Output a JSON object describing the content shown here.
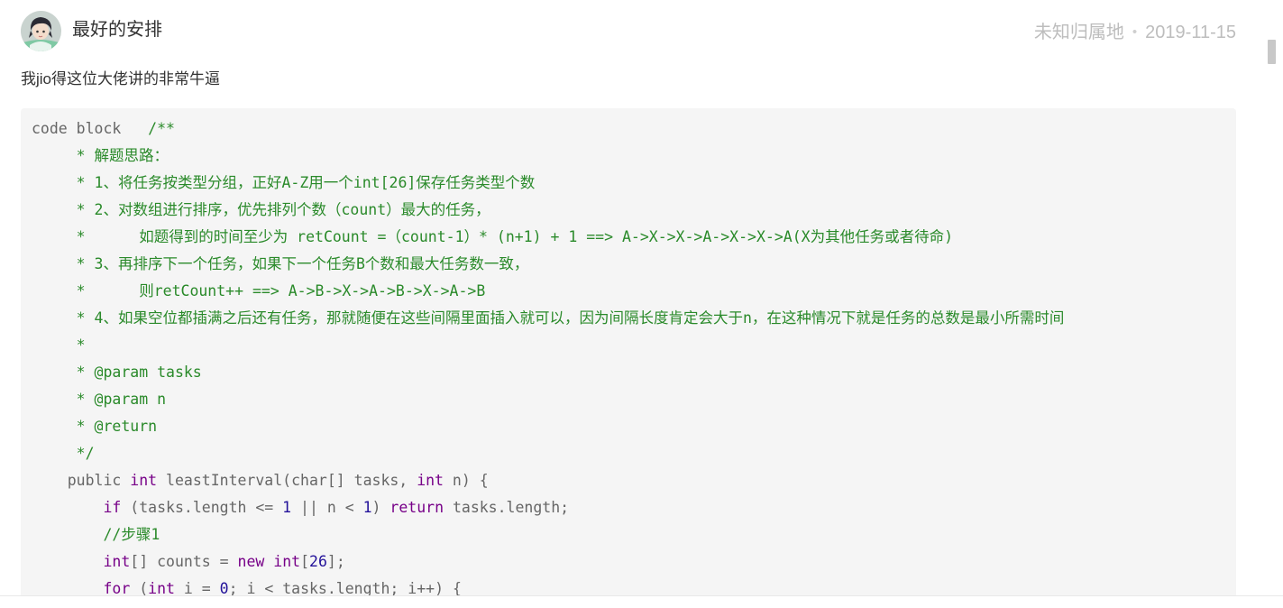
{
  "comment": {
    "avatar_icon": "user-avatar",
    "author": "最好的安排",
    "location": "未知归属地",
    "separator": "•",
    "date": "2019-11-15",
    "text": "我jio得这位大佬讲的非常牛逼",
    "code": {
      "colors": {
        "plain": "#666666",
        "comment": "#2a8a2a",
        "keyword": "#770088",
        "number": "#221199"
      },
      "lines": [
        [
          {
            "t": "code block   ",
            "k": "plain"
          },
          {
            "t": "/**",
            "k": "comment"
          }
        ],
        [
          {
            "t": "     * 解题思路：",
            "k": "comment"
          }
        ],
        [
          {
            "t": "     * 1、将任务按类型分组，正好A-Z用一个int[26]保存任务类型个数",
            "k": "comment"
          }
        ],
        [
          {
            "t": "     * 2、对数组进行排序，优先排列个数（count）最大的任务，",
            "k": "comment"
          }
        ],
        [
          {
            "t": "     *      如题得到的时间至少为 retCount =（count-1）* (n+1) + 1 ==> A->X->X->A->X->X->A(X为其他任务或者待命)",
            "k": "comment"
          }
        ],
        [
          {
            "t": "     * 3、再排序下一个任务，如果下一个任务B个数和最大任务数一致，",
            "k": "comment"
          }
        ],
        [
          {
            "t": "     *      则retCount++ ==> A->B->X->A->B->X->A->B",
            "k": "comment"
          }
        ],
        [
          {
            "t": "     * 4、如果空位都插满之后还有任务，那就随便在这些间隔里面插入就可以，因为间隔长度肯定会大于n，在这种情况下就是任务的总数是最小所需时间",
            "k": "comment"
          }
        ],
        [
          {
            "t": "     *",
            "k": "comment"
          }
        ],
        [
          {
            "t": "     * @param tasks",
            "k": "comment"
          }
        ],
        [
          {
            "t": "     * @param n",
            "k": "comment"
          }
        ],
        [
          {
            "t": "     * @return",
            "k": "comment"
          }
        ],
        [
          {
            "t": "     */",
            "k": "comment"
          }
        ],
        [
          {
            "t": "    public ",
            "k": "plain"
          },
          {
            "t": "int",
            "k": "keyword"
          },
          {
            "t": " leastInterval(char[] tasks, ",
            "k": "plain"
          },
          {
            "t": "int",
            "k": "keyword"
          },
          {
            "t": " n) {",
            "k": "plain"
          }
        ],
        [
          {
            "t": "        ",
            "k": "plain"
          },
          {
            "t": "if",
            "k": "keyword"
          },
          {
            "t": " (tasks.length <= ",
            "k": "plain"
          },
          {
            "t": "1",
            "k": "number"
          },
          {
            "t": " || n < ",
            "k": "plain"
          },
          {
            "t": "1",
            "k": "number"
          },
          {
            "t": ") ",
            "k": "plain"
          },
          {
            "t": "return",
            "k": "keyword"
          },
          {
            "t": " tasks.length;",
            "k": "plain"
          }
        ],
        [
          {
            "t": "        ",
            "k": "plain"
          },
          {
            "t": "//步骤1",
            "k": "comment"
          }
        ],
        [
          {
            "t": "        ",
            "k": "plain"
          },
          {
            "t": "int",
            "k": "keyword"
          },
          {
            "t": "[] counts = ",
            "k": "plain"
          },
          {
            "t": "new",
            "k": "keyword"
          },
          {
            "t": " ",
            "k": "plain"
          },
          {
            "t": "int",
            "k": "keyword"
          },
          {
            "t": "[",
            "k": "plain"
          },
          {
            "t": "26",
            "k": "number"
          },
          {
            "t": "];",
            "k": "plain"
          }
        ],
        [
          {
            "t": "        ",
            "k": "plain"
          },
          {
            "t": "for",
            "k": "keyword"
          },
          {
            "t": " (",
            "k": "plain"
          },
          {
            "t": "int",
            "k": "keyword"
          },
          {
            "t": " i = ",
            "k": "plain"
          },
          {
            "t": "0",
            "k": "number"
          },
          {
            "t": "; i < tasks.length; i++) {",
            "k": "plain"
          }
        ]
      ]
    }
  }
}
